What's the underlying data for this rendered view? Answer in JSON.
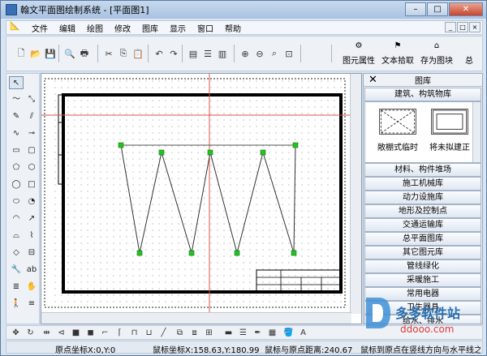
{
  "window": {
    "title": "翰文平面图绘制系统 - [平面图1]",
    "controls": {
      "minimize": "–",
      "maximize": "□",
      "close": "✕"
    }
  },
  "menu": {
    "items": [
      "文件",
      "编辑",
      "绘图",
      "修改",
      "图库",
      "显示",
      "窗口",
      "帮助"
    ],
    "mdi_controls": [
      "_",
      "□",
      "×"
    ]
  },
  "toolbar": {
    "buttons": [
      {
        "icon": "new-file-icon",
        "glyph": "🗋"
      },
      {
        "icon": "open-folder-icon",
        "glyph": "📂"
      },
      {
        "icon": "save-icon",
        "glyph": "💾"
      },
      {
        "icon": "print-preview-icon",
        "glyph": "🔍"
      },
      {
        "icon": "print-icon",
        "glyph": "🖶"
      },
      {
        "icon": "cut-icon",
        "glyph": "✂"
      },
      {
        "icon": "copy-icon",
        "glyph": "⎘"
      },
      {
        "icon": "paste-icon",
        "glyph": "📋"
      },
      {
        "icon": "undo-icon",
        "glyph": "↶"
      },
      {
        "icon": "redo-icon",
        "glyph": "↷"
      },
      {
        "icon": "tile-window-icon",
        "glyph": "▤"
      },
      {
        "icon": "horizontal-split-icon",
        "glyph": "☰"
      },
      {
        "icon": "vertical-split-icon",
        "glyph": "▥"
      },
      {
        "icon": "zoom-in-icon",
        "glyph": "⊕"
      },
      {
        "icon": "zoom-out-icon",
        "glyph": "⊖"
      },
      {
        "icon": "zoom-icon",
        "glyph": "⌕"
      },
      {
        "icon": "zoom-window-icon",
        "glyph": "⊡"
      }
    ],
    "big_buttons": {
      "element_props": "图元属性",
      "text_pick": "文本拾取",
      "save_as_block": "存为图块",
      "more": "总"
    }
  },
  "left_tools": [
    {
      "name": "select-arrow-icon",
      "glyph": "↖"
    },
    {
      "name": "polyline-icon",
      "glyph": "〜"
    },
    {
      "name": "dimension-icon",
      "glyph": "⤡"
    },
    {
      "name": "pencil-icon",
      "glyph": "✎"
    },
    {
      "name": "hatch-line-icon",
      "glyph": "⫽"
    },
    {
      "name": "curve-icon",
      "glyph": "∿"
    },
    {
      "name": "arrow-line-icon",
      "glyph": "⊸"
    },
    {
      "name": "rectangle-icon",
      "glyph": "▭"
    },
    {
      "name": "rounded-rect-icon",
      "glyph": "▢"
    },
    {
      "name": "pentagon-icon",
      "glyph": "⬠"
    },
    {
      "name": "hexagon-icon",
      "glyph": "⬡"
    },
    {
      "name": "circle-icon",
      "glyph": "◯"
    },
    {
      "name": "square-icon",
      "glyph": "□"
    },
    {
      "name": "ellipse-icon",
      "glyph": "⬭"
    },
    {
      "name": "pie-icon",
      "glyph": "◔"
    },
    {
      "name": "arc-icon",
      "glyph": "◠"
    },
    {
      "name": "red-arc-icon",
      "glyph": "↗"
    },
    {
      "name": "half-circle-icon",
      "glyph": "⌓"
    },
    {
      "name": "wave-icon",
      "glyph": "⌇"
    },
    {
      "name": "diamond-icon",
      "glyph": "◇"
    },
    {
      "name": "label-icon",
      "glyph": "⊟"
    },
    {
      "name": "wrench-icon",
      "glyph": "🔧"
    },
    {
      "name": "text-ab-icon",
      "glyph": "ab"
    },
    {
      "name": "multiline-text-icon",
      "glyph": "≣"
    },
    {
      "name": "hand-icon",
      "glyph": "✋"
    },
    {
      "name": "person-icon",
      "glyph": "🚶"
    },
    {
      "name": "stack-icon",
      "glyph": "≡"
    }
  ],
  "library_panel": {
    "title": "图库",
    "active_category": "建筑、构筑物库",
    "items": [
      {
        "label": "敞棚式临时",
        "thumb_style": "dashed-cross"
      },
      {
        "label": "将未拟建正",
        "thumb_style": "double-rect"
      }
    ],
    "categories": [
      "材料、构件堆场",
      "施工机械库",
      "动力设施库",
      "地形及控制点",
      "交通运输库",
      "总平面图库",
      "其它图元库",
      "管线绿化",
      "采暖施工",
      "常用电器",
      "卫生器具",
      "给水、排水"
    ]
  },
  "bottom_tools": [
    {
      "name": "move-icon",
      "glyph": "✥"
    },
    {
      "name": "rotate-icon",
      "glyph": "↻"
    },
    {
      "name": "scale-icon",
      "glyph": "⇹"
    },
    {
      "name": "mirror-icon",
      "glyph": "⊲"
    },
    {
      "name": "fill-square-icon",
      "glyph": "■"
    },
    {
      "name": "filled-square-icon",
      "glyph": "◼"
    },
    {
      "name": "trim-icon",
      "glyph": "⌐"
    },
    {
      "name": "extend-icon",
      "glyph": "⌈"
    },
    {
      "name": "offset-icon",
      "glyph": "⊓"
    },
    {
      "name": "break-icon",
      "glyph": "⊔"
    },
    {
      "name": "line-edit-icon",
      "glyph": "╱"
    },
    {
      "name": "group-icon",
      "glyph": "⧉"
    },
    {
      "name": "ungroup-icon",
      "glyph": "⧈"
    },
    {
      "name": "align-icon",
      "glyph": "⊞"
    },
    {
      "name": "line-style-icon",
      "glyph": "▬"
    },
    {
      "name": "line-width-icon",
      "glyph": "☰"
    },
    {
      "name": "pen-color-icon",
      "glyph": "✒"
    },
    {
      "name": "layer-icon",
      "glyph": "▦"
    },
    {
      "name": "bucket-icon",
      "glyph": "🪣"
    },
    {
      "name": "text-color-icon",
      "glyph": "A"
    }
  ],
  "status": {
    "origin": "原点坐标X:0,Y:0",
    "mouse": "鼠标坐标X:158.63,Y:180.99",
    "distance": "鼠标与原点距离:240.67",
    "hint": "鼠标到原点在竖线方向与水平线之间的距离"
  },
  "watermark": {
    "brand": "多多软件站",
    "url": "ddooo.com"
  },
  "colors": {
    "accent": "#2a6fb0",
    "crosshair": "#d9534f",
    "handle": "#22c322",
    "grid": "#c8c8c8"
  }
}
